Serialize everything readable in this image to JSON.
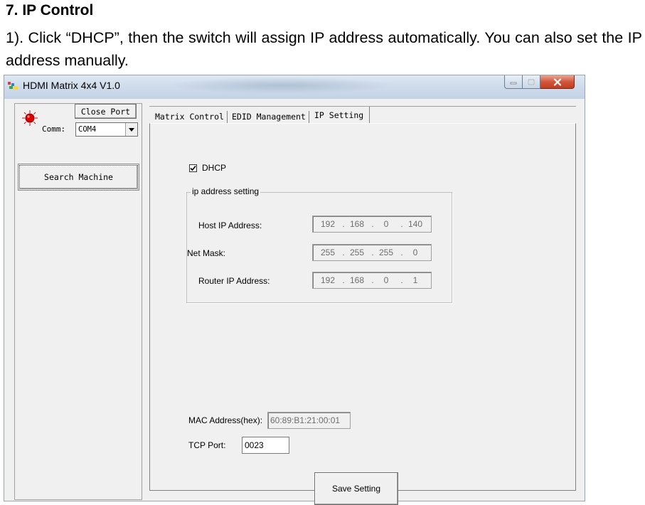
{
  "document": {
    "heading": "7. IP Control",
    "paragraph": "1). Click “DHCP”, then the switch will assign IP address automatically. You can also set the IP address manually."
  },
  "window": {
    "title": "HDMI Matrix 4x4 V1.0",
    "caption_buttons": [
      "minimize",
      "maximize",
      "close"
    ]
  },
  "left_panel": {
    "close_port_label": "Close Port",
    "comm_label": "Comm:",
    "comm_value": "COM4",
    "search_label": "Search Machine",
    "led_color": "#e00000"
  },
  "tabs": [
    {
      "label": "Matrix Control",
      "active": false
    },
    {
      "label": "EDID Management",
      "active": false
    },
    {
      "label": "IP Setting",
      "active": true
    }
  ],
  "ip_setting": {
    "dhcp_label": "DHCP",
    "dhcp_checked": true,
    "group_title": "ip address setting",
    "host_ip": {
      "label": "Host IP Address:",
      "octets": [
        "192",
        "168",
        "0",
        "140"
      ]
    },
    "net_mask": {
      "label": "Net Mask:",
      "octets": [
        "255",
        "255",
        "255",
        "0"
      ]
    },
    "router_ip": {
      "label": "Router IP Address:",
      "octets": [
        "192",
        "168",
        "0",
        "1"
      ]
    },
    "mac_label": "MAC Address(hex):",
    "mac_value": "60:89:B1:21:00:01",
    "tcp_label": "TCP Port:",
    "tcp_value": "0023",
    "save_label": "Save Setting"
  }
}
